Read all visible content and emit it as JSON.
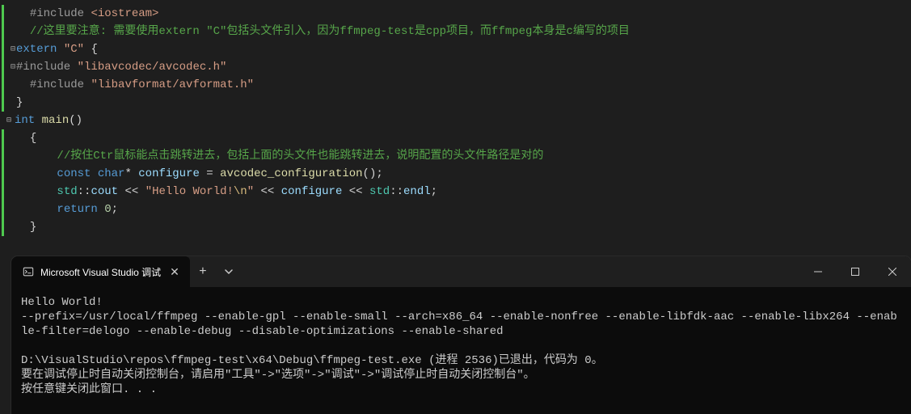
{
  "editor": {
    "lines": [
      {
        "fold": "",
        "html": "<span class='c-preproc'>#include</span> <span class='c-string'>&lt;iostream&gt;</span>",
        "green": true,
        "indent": "  "
      },
      {
        "fold": "",
        "html": "<span class='c-comment'>//这里要注意: 需要使用extern \"C\"包括头文件引入，因为ffmpeg-test是cpp项目，而ffmpeg本身是c编写的项目</span>",
        "green": true,
        "indent": "  "
      },
      {
        "fold": "⊟",
        "html": "<span class='c-keyword'>extern</span> <span class='c-string'>\"C\"</span> <span class='c-punc'>{</span>",
        "green": true,
        "indent": ""
      },
      {
        "fold": "⊟",
        "html": "<span class='c-preproc'>#include</span> <span class='c-string'>\"libavcodec/avcodec.h\"</span>",
        "green": true,
        "indent": ""
      },
      {
        "fold": "",
        "html": "<span class='c-preproc'>#include</span> <span class='c-string'>\"libavformat/avformat.h\"</span>",
        "green": true,
        "indent": "  "
      },
      {
        "fold": "",
        "html": "<span class='c-punc'>}</span>",
        "green": true,
        "indent": ""
      },
      {
        "fold": "",
        "html": "",
        "green": false,
        "indent": ""
      },
      {
        "fold": "⊟",
        "html": "<span class='c-type'>int</span> <span class='c-func'>main</span><span class='c-punc'>()</span>",
        "green": false,
        "indent": ""
      },
      {
        "fold": "",
        "html": "<span class='c-punc'>{</span>",
        "green": true,
        "indent": "  "
      },
      {
        "fold": "",
        "html": "    <span class='c-comment'>//按住Ctr鼠标能点击跳转进去，包括上面的头文件也能跳转进去，说明配置的头文件路径是对的</span>",
        "green": true,
        "indent": "  "
      },
      {
        "fold": "",
        "html": "    <span class='c-keyword'>const</span> <span class='c-type'>char</span><span class='c-punc'>*</span> <span class='c-var'>configure</span> <span class='c-punc'>=</span> <span class='c-func'>avcodec_configuration</span><span class='c-punc'>();</span>",
        "green": true,
        "indent": "  "
      },
      {
        "fold": "",
        "html": "    <span class='c-ns'>std</span><span class='c-punc'>::</span><span class='c-var'>cout</span> <span class='c-punc'>&lt;&lt;</span> <span class='c-string'>\"Hello World!</span><span class='c-escape'>\\n</span><span class='c-string'>\"</span> <span class='c-punc'>&lt;&lt;</span> <span class='c-var'>configure</span> <span class='c-punc'>&lt;&lt;</span> <span class='c-ns'>std</span><span class='c-punc'>::</span><span class='c-var'>endl</span><span class='c-punc'>;</span>",
        "green": true,
        "indent": "  "
      },
      {
        "fold": "",
        "html": "    <span class='c-keyword'>return</span> <span class='c-num'>0</span><span class='c-punc'>;</span>",
        "green": true,
        "indent": "  "
      },
      {
        "fold": "",
        "html": "<span class='c-punc'>}</span>",
        "green": true,
        "indent": "  "
      }
    ]
  },
  "terminal": {
    "tab_title": "Microsoft Visual Studio 调试",
    "output": "Hello World!\n--prefix=/usr/local/ffmpeg --enable-gpl --enable-small --arch=x86_64 --enable-nonfree --enable-libfdk-aac --enable-libx264 --enable-filter=delogo --enable-debug --disable-optimizations --enable-shared\n\nD:\\VisualStudio\\repos\\ffmpeg-test\\x64\\Debug\\ffmpeg-test.exe (进程 2536)已退出，代码为 0。\n要在调试停止时自动关闭控制台，请启用\"工具\"->\"选项\"->\"调试\"->\"调试停止时自动关闭控制台\"。\n按任意键关闭此窗口. . ."
  }
}
